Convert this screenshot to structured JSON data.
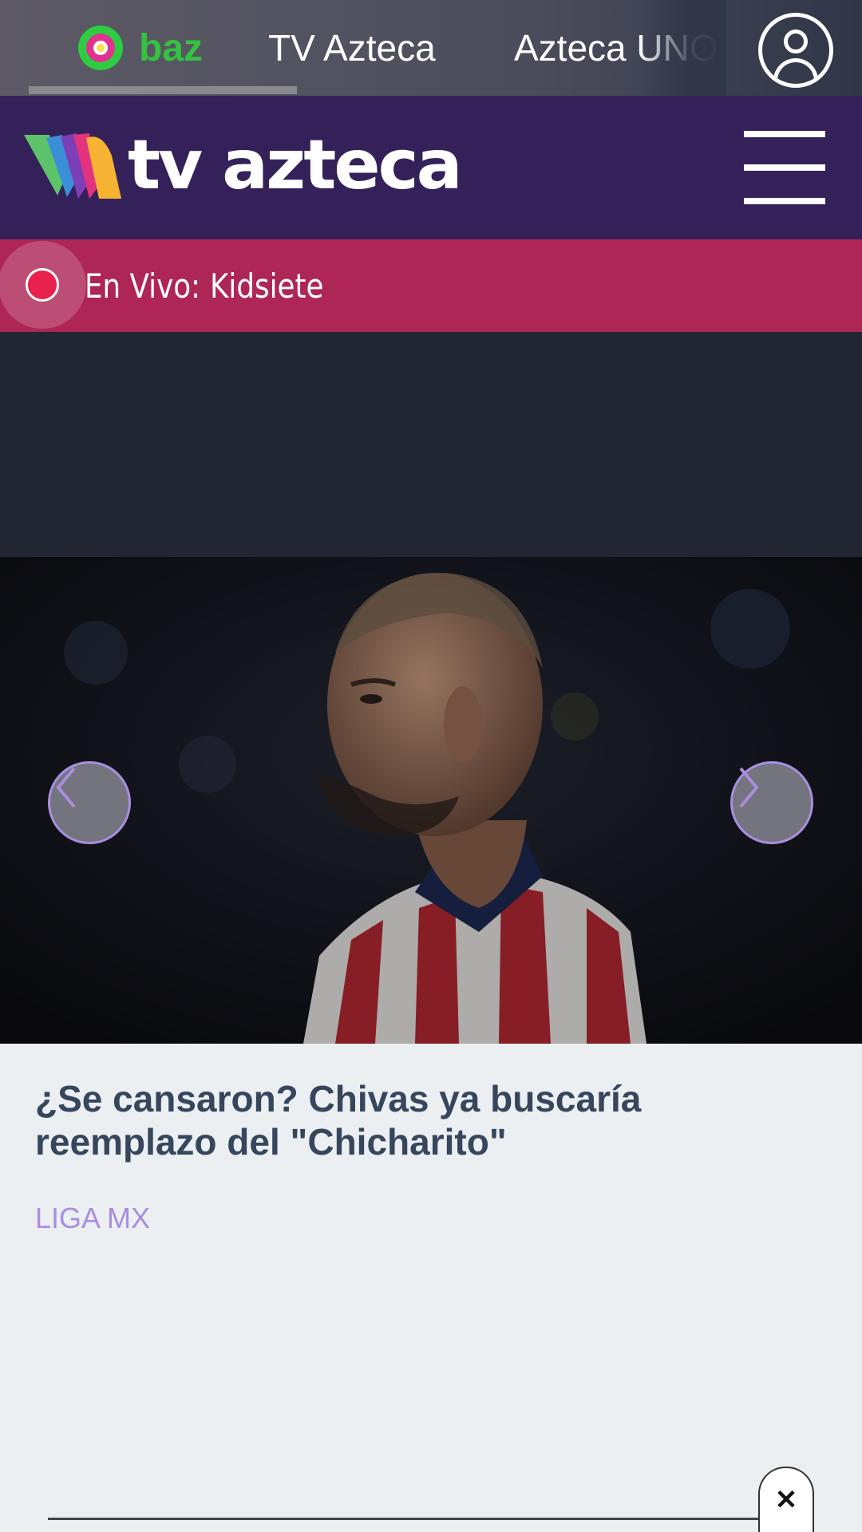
{
  "network_bar": {
    "tabs": [
      {
        "label": "baz"
      },
      {
        "label": "TV Azteca"
      },
      {
        "label": "Azteca UNO"
      }
    ]
  },
  "header": {
    "logo_text": "tv azteca"
  },
  "live": {
    "prefix": "En Vivo:",
    "channel": "Kidsiete"
  },
  "article": {
    "headline": "¿Se cansaron? Chivas ya buscaría reemplazo del \"Chicharito\"",
    "category": "LIGA MX"
  },
  "colors": {
    "header_bg": "#35215a",
    "live_bg": "#ae2656",
    "category": "#a98ee0",
    "headline": "#35465d"
  },
  "icons": {
    "user": "user-circle-icon",
    "menu": "hamburger-menu-icon",
    "prev": "chevron-left-icon",
    "next": "chevron-right-icon",
    "close": "close-icon"
  }
}
